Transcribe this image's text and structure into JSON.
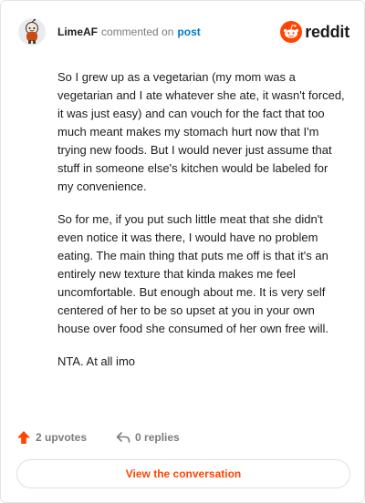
{
  "comment": {
    "username": "LimeAF",
    "action_text": "commented on",
    "post_link": "post",
    "paragraphs": [
      "So I grew up as a vegetarian (my mom was a vegetarian and I ate whatever she ate, it wasn't forced, it was just easy) and can vouch for the fact that too much meant makes my stomach hurt now that I'm trying new foods. But I would never just assume that stuff in someone else's kitchen would be labeled for my convenience.",
      "So for me, if you put such little meat that she didn't even notice it was there, I would have no problem eating. The main thing that puts me off is that it's an entirely new texture that kinda makes me feel uncomfortable. But enough about me. It is very self centered of her to be so upset at you in your own house over food she consumed of her own free will.",
      "NTA. At all imo"
    ]
  },
  "brand": {
    "wordmark": "reddit",
    "icon": "reddit-snoo-icon"
  },
  "actions": {
    "upvotes_label": "2 upvotes",
    "replies_label": "0 replies"
  },
  "view_button_label": "View the conversation",
  "colors": {
    "accent": "#ff4500",
    "link": "#0079d3",
    "muted": "#7c7c7c",
    "text": "#1c1c1c"
  }
}
